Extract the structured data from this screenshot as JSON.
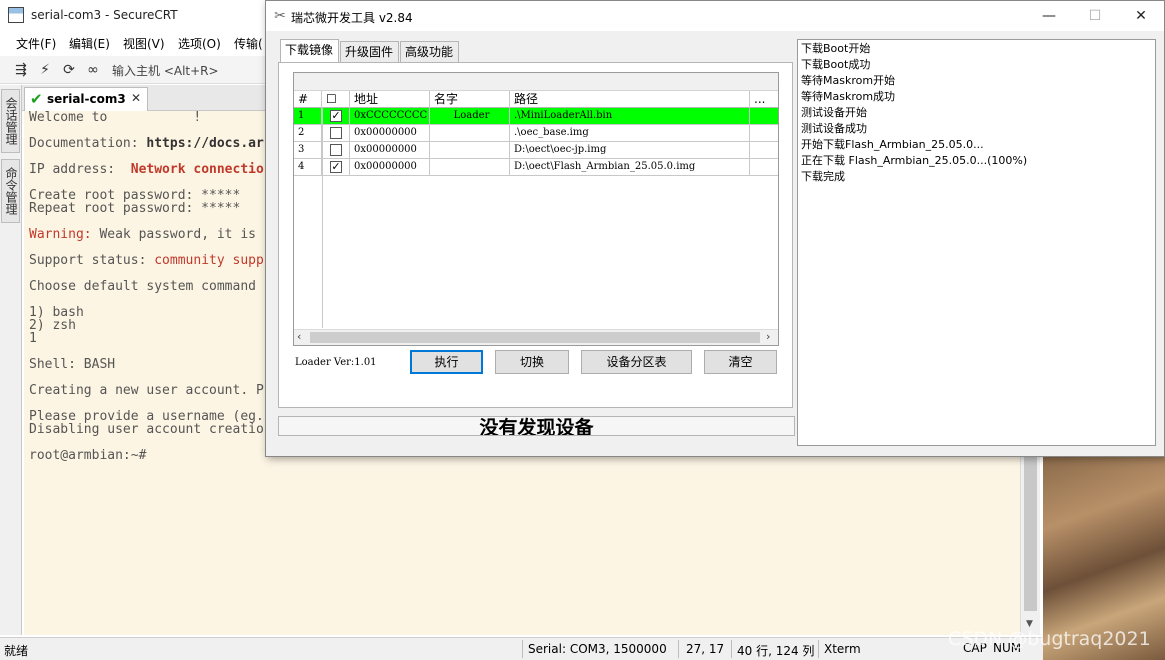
{
  "crt": {
    "title": "serial-com3 - SecureCRT",
    "menu": [
      "文件(F)",
      "编辑(E)",
      "视图(V)",
      "选项(O)",
      "传输("
    ],
    "quick_connect": "输入主机 <Alt+R>",
    "session_tab": "serial-com3",
    "side_tabs": [
      "会话管理",
      "命令管理"
    ],
    "terminal": {
      "l1": "Welcome to           !",
      "l2a": "Documentation: ",
      "l2b": "https://docs.ar",
      "l3a": "IP address:  ",
      "l3b": "Network connectio",
      "l4": "Create root password: *****",
      "l5": "Repeat root password: *****",
      "l6a": "Warning:",
      "l6b": " Weak password, it is",
      "l7a": "Support status: ",
      "l7b": "community supp",
      "l8": "Choose default system command",
      "l9": "1) bash",
      "l10": "2) zsh",
      "l11": "1",
      "l12": "Shell: BASH",
      "l13": "Creating a new user account. P",
      "l14": "Please provide a username (eg.",
      "l15": "Disabling user account creatio",
      "l16": "root@armbian:~#"
    },
    "status": {
      "ready": "就绪",
      "serial": "Serial: COM3, 1500000",
      "pos": "27,  17",
      "size": "40 行, 124 列",
      "term": "Xterm",
      "cap": "CAP",
      "num": "NUM"
    }
  },
  "rk": {
    "title": "瑞芯微开发工具 v2.84",
    "tabs": [
      "下载镜像",
      "升级固件",
      "高级功能"
    ],
    "grid": {
      "headers": [
        "#",
        "☐",
        "地址",
        "名字",
        "路径",
        "..."
      ],
      "rows": [
        {
          "n": "1",
          "checked": "✓",
          "addr": "0xCCCCCCCC",
          "name": "Loader",
          "path": ".\\MiniLoaderAll.bin"
        },
        {
          "n": "2",
          "checked": "",
          "addr": "0x00000000",
          "name": "",
          "path": ".\\oec_base.img"
        },
        {
          "n": "3",
          "checked": "",
          "addr": "0x00000000",
          "name": "",
          "path": "D:\\oect\\oec-jp.img"
        },
        {
          "n": "4",
          "checked": "✓",
          "addr": "0x00000000",
          "name": "",
          "path": "D:\\oect\\Flash_Armbian_25.05.0.img"
        }
      ]
    },
    "loader_ver": "Loader Ver:1.01",
    "buttons": {
      "run": "执行",
      "switch": "切换",
      "partition": "设备分区表",
      "clear": "清空"
    },
    "device_status": "没有发现设备",
    "log": [
      "下载Boot开始",
      "下载Boot成功",
      "等待Maskrom开始",
      "等待Maskrom成功",
      "测试设备开始",
      "测试设备成功",
      "开始下载Flash_Armbian_25.05.0...",
      "正在下载 Flash_Armbian_25.05.0...(100%)",
      "下载完成"
    ]
  },
  "watermark": "CSDN @bugtraq2021"
}
